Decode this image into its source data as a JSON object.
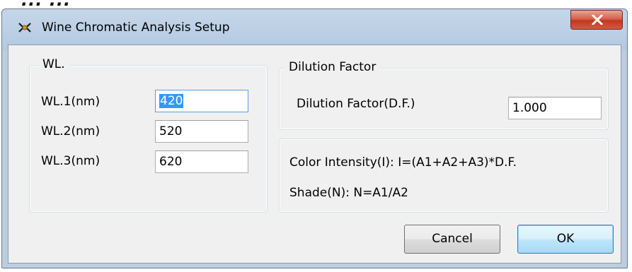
{
  "window": {
    "title": "Wine Chromatic Analysis Setup",
    "close_symbol": "X",
    "app_icon": "wine-glass-icon"
  },
  "wl_group": {
    "legend": "WL.",
    "rows": [
      {
        "label": "WL.1(nm)",
        "value": "420"
      },
      {
        "label": "WL.2(nm)",
        "value": "520"
      },
      {
        "label": "WL.3(nm)",
        "value": "620"
      }
    ]
  },
  "dilution_group": {
    "legend": "Dilution Factor",
    "label": "Dilution Factor(D.F.)",
    "value": "1.000"
  },
  "formulas": {
    "color_intensity": "Color Intensity(I): I=(A1+A2+A3)*D.F.",
    "shade": "Shade(N): N=A1/A2"
  },
  "buttons": {
    "cancel": "Cancel",
    "ok": "OK"
  },
  "colors": {
    "selection": "#3399ff",
    "close_button": "#c2381f",
    "titlebar": "#bcd0e6"
  }
}
